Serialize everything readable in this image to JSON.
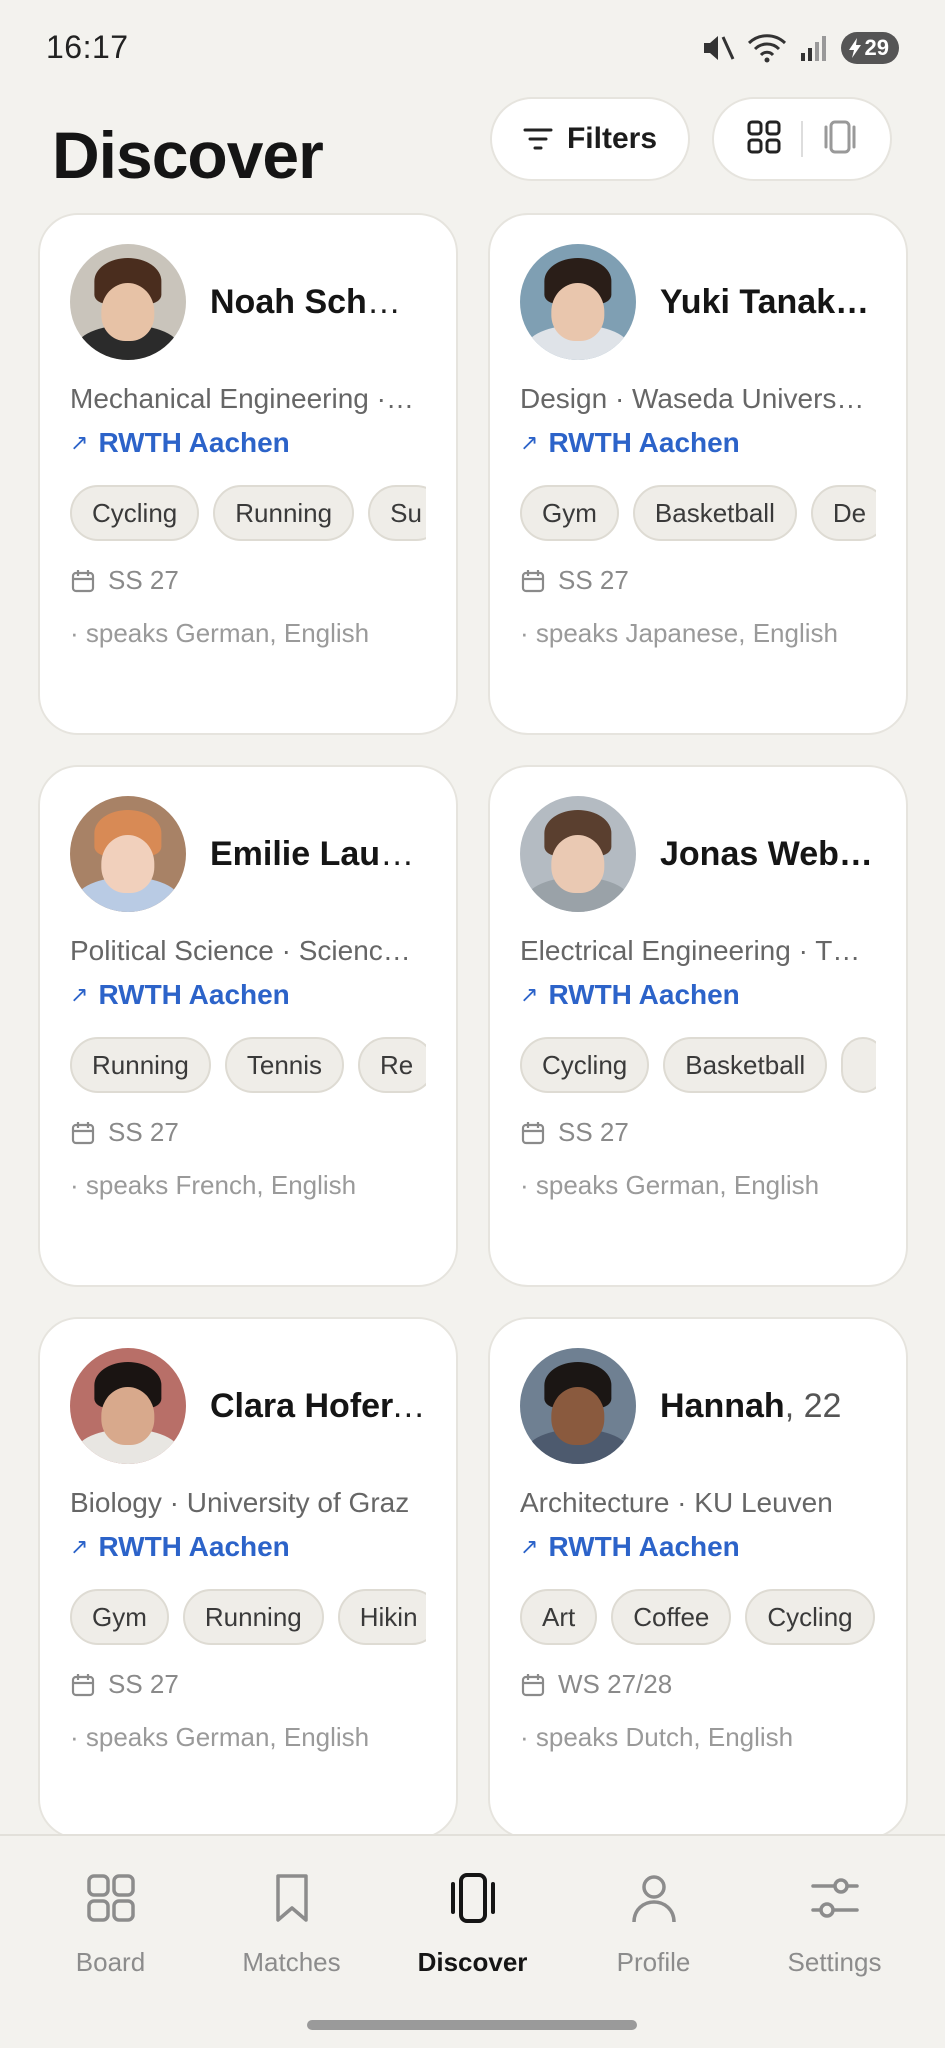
{
  "status_bar": {
    "time": "16:17",
    "battery": "29"
  },
  "header": {
    "title": "Discover",
    "filters_label": "Filters"
  },
  "profiles": [
    {
      "name": "Noah Schm…",
      "age": "",
      "subtitle": "Mechanical Engineering ·…",
      "university": "RWTH Aachen",
      "tags": [
        "Cycling",
        "Running",
        "Su"
      ],
      "semester": "SS 27",
      "languages": "· speaks German, English",
      "avatar_bg": "#c9c4bb",
      "skin": "#e7c2a6",
      "hair": "#4a2d1e",
      "shirt": "#2b2b2b"
    },
    {
      "name": "Yuki Tanak…",
      "age": "",
      "subtitle": "Design · Waseda Univers…",
      "university": "RWTH Aachen",
      "tags": [
        "Gym",
        "Basketball",
        "De"
      ],
      "semester": "SS 27",
      "languages": "· speaks Japanese, English",
      "avatar_bg": "#7f9fb3",
      "skin": "#e9c6ad",
      "hair": "#2a1e18",
      "shirt": "#dfe3e8"
    },
    {
      "name": "Emilie Laur…",
      "age": "",
      "subtitle": "Political Science · Scienc…",
      "university": "RWTH Aachen",
      "tags": [
        "Running",
        "Tennis",
        "Re"
      ],
      "semester": "SS 27",
      "languages": "· speaks French, English",
      "avatar_bg": "#a88266",
      "skin": "#f1d0bc",
      "hair": "#d88a55",
      "shirt": "#b9cbe4"
    },
    {
      "name": "Jonas Web…",
      "age": "",
      "subtitle": "Electrical Engineering · T…",
      "university": "RWTH Aachen",
      "tags": [
        "Cycling",
        "Basketball",
        ""
      ],
      "semester": "SS 27",
      "languages": "· speaks German, English",
      "avatar_bg": "#b4bbc2",
      "skin": "#eac9b3",
      "hair": "#5a3f2f",
      "shirt": "#9aa2a8"
    },
    {
      "name": "Clara Hofer,…",
      "age": "",
      "subtitle": "Biology · University of Graz",
      "university": "RWTH Aachen",
      "tags": [
        "Gym",
        "Running",
        "Hikin"
      ],
      "semester": "SS 27",
      "languages": "· speaks German, English",
      "avatar_bg": "#b86f68",
      "skin": "#d8a98c",
      "hair": "#1a1412",
      "shirt": "#e8e6e2"
    },
    {
      "name": "Hannah",
      "age": ", 22",
      "subtitle": "Architecture · KU Leuven",
      "university": "RWTH Aachen",
      "tags": [
        "Art",
        "Coffee",
        "Cycling"
      ],
      "semester": "WS 27/28",
      "languages": "· speaks Dutch, English",
      "avatar_bg": "#6f8092",
      "skin": "#8a5a3e",
      "hair": "#1b1614",
      "shirt": "#4d5a6e"
    }
  ],
  "nav": [
    {
      "label": "Board",
      "icon": "grid-icon",
      "active": false
    },
    {
      "label": "Matches",
      "icon": "bookmark-icon",
      "active": false
    },
    {
      "label": "Discover",
      "icon": "card-icon",
      "active": true
    },
    {
      "label": "Profile",
      "icon": "person-icon",
      "active": false
    },
    {
      "label": "Settings",
      "icon": "sliders-icon",
      "active": false
    }
  ],
  "colors": {
    "accent_link": "#2c63c9",
    "background": "#f3f2ee",
    "card": "#ffffff"
  }
}
